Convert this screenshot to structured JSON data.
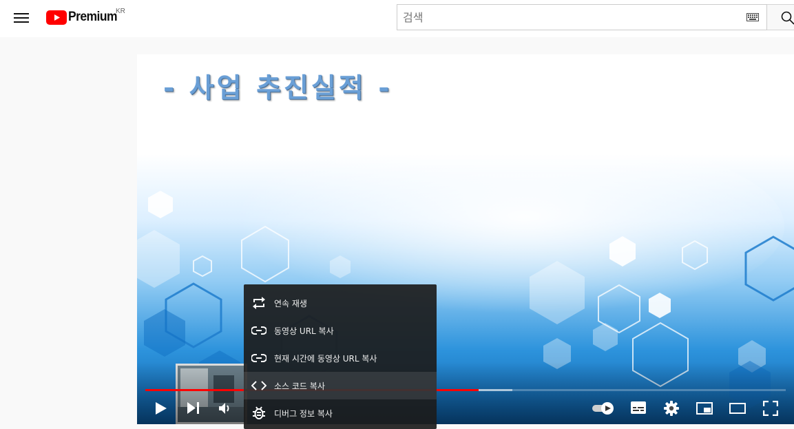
{
  "header": {
    "logo_text": "Premium",
    "logo_country": "KR",
    "search": {
      "placeholder": "검색"
    }
  },
  "video": {
    "slide_title": "- 사업 추진실적 -",
    "progress": {
      "played_fraction": 0.52,
      "buffered_fraction": 0.573
    }
  },
  "context_menu": {
    "items": [
      {
        "label": "연속 재생",
        "icon": "loop-icon"
      },
      {
        "label": "동영상 URL 복사",
        "icon": "link-icon"
      },
      {
        "label": "현재 시간에 동영상 URL 복사",
        "icon": "link-icon"
      },
      {
        "label": "소스 코드 복사",
        "icon": "code-icon"
      },
      {
        "label": "디버그 정보 복사",
        "icon": "bug-icon"
      }
    ]
  },
  "controls": {
    "left": [
      "play-icon",
      "next-icon",
      "volume-icon"
    ],
    "right": [
      "autoplay-toggle",
      "subtitles-icon",
      "settings-icon",
      "miniplayer-icon",
      "theater-icon",
      "fullscreen-icon"
    ]
  },
  "colors": {
    "brand_red": "#ff0000",
    "slide_title": "#6a9fd6",
    "menu_bg": "#1c1c1c"
  }
}
